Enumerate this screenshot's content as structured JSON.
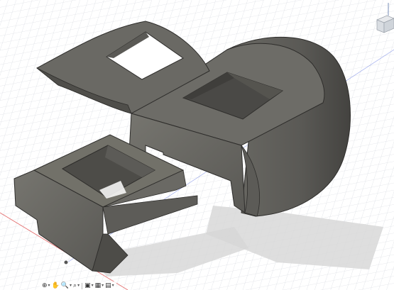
{
  "app": {
    "view": "3D model viewport",
    "background": "#ffffff",
    "grid_color": "#c9ced6",
    "axis_x_color": "#e46a6a",
    "axis_y_color": "#6a7ee4"
  },
  "model": {
    "parts": [
      "top-cap",
      "main-housing",
      "small-holder"
    ],
    "body_color_light": "#6f6e69",
    "body_color_mid": "#5c5b57",
    "body_color_dark": "#4a4946",
    "shadow_color": "#d4d4d4"
  },
  "viewcube": {
    "face_label": ""
  },
  "navbar": {
    "items": [
      {
        "icon": "orbit-icon",
        "glyph": "⊕",
        "has_menu": true
      },
      {
        "icon": "pan-icon",
        "glyph": "✋",
        "has_menu": false
      },
      {
        "icon": "zoom-icon",
        "glyph": "🔍",
        "has_menu": true
      },
      {
        "icon": "look-at-icon",
        "glyph": "⌕",
        "has_menu": true
      },
      {
        "icon": "display-settings-icon",
        "glyph": "▣",
        "has_menu": true
      },
      {
        "icon": "grid-settings-icon",
        "glyph": "▦",
        "has_menu": true
      },
      {
        "icon": "viewports-icon",
        "glyph": "▤",
        "has_menu": true
      }
    ]
  }
}
